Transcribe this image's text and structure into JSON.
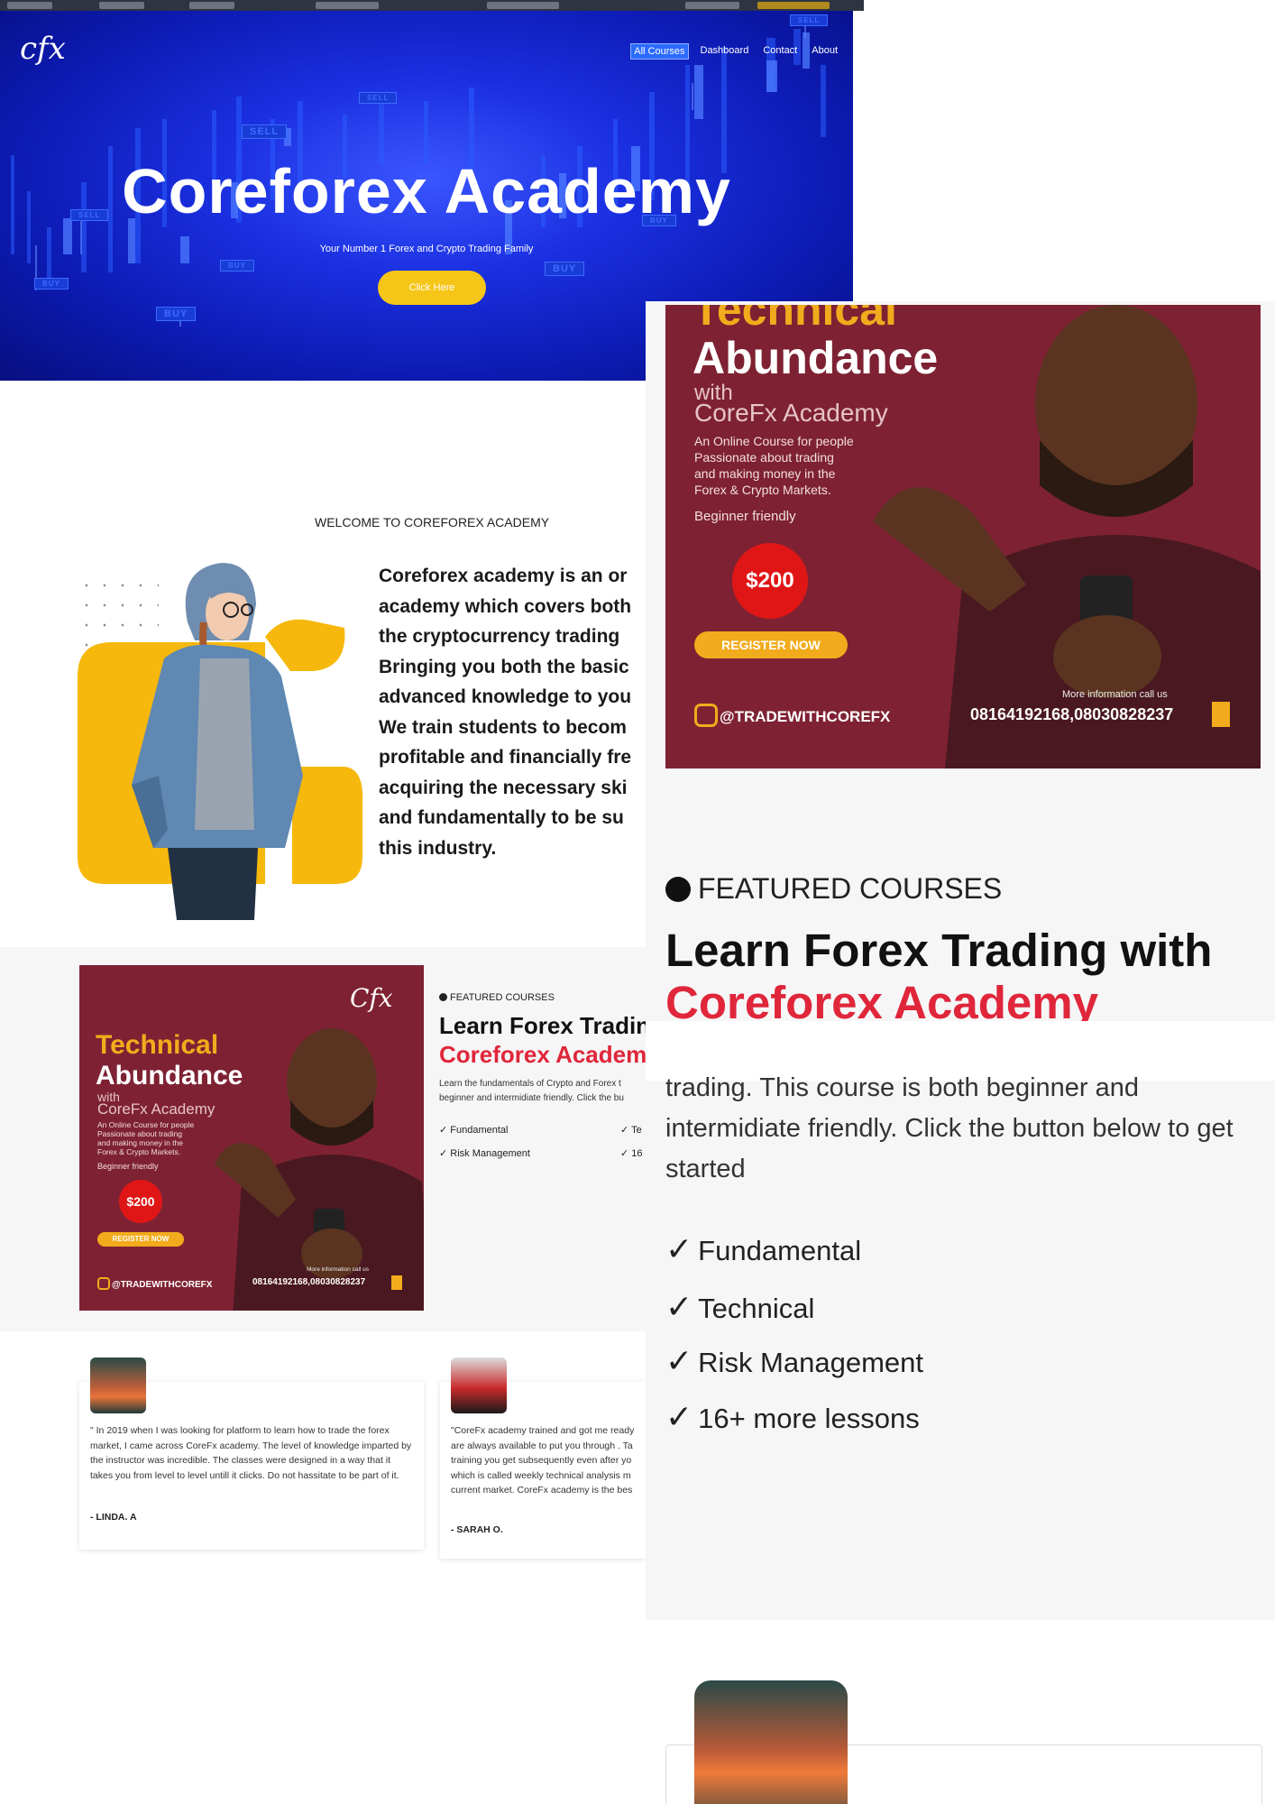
{
  "nav": {
    "logo": "cfx",
    "items": [
      "All Courses",
      "Dashboard",
      "Contact",
      "About"
    ]
  },
  "hero": {
    "title": "Coreforex Academy",
    "subtitle": "Your Number 1 Forex and Crypto Trading Family",
    "button": "Click Here",
    "tags": [
      "SELL",
      "SELL",
      "SELL",
      "SELL",
      "BUY",
      "BUY",
      "BUY",
      "BUY",
      "BUY"
    ]
  },
  "welcome": {
    "label": "WELCOME TO COREFOREX ACADEMY",
    "lines": [
      "Coreforex academy is an or",
      "academy which covers both",
      "the cryptocurrency trading",
      "Bringing you both the basic",
      "advanced knowledge to you",
      "We train students to becom",
      "profitable and financially fre",
      "acquiring the necessary ski",
      "and fundamentally to be su",
      "this industry."
    ]
  },
  "poster": {
    "title_line1": "Technical",
    "title_line2": "Abundance",
    "with": "with",
    "brand": "CoreFx Academy",
    "desc": [
      "An Online Course for people",
      "Passionate about trading",
      "and making money in the",
      "Forex & Crypto Markets."
    ],
    "beginner": "Beginner friendly",
    "price": "$200",
    "register": "REGISTER NOW",
    "instagram": "@TRADEWITHCOREFX",
    "more_info": "More information call us",
    "phones": "08164192168,08030828237",
    "logo": "Cfx"
  },
  "featured": {
    "label": "FEATURED COURSES",
    "heading1": "Learn Forex Trading with",
    "heading2": "Coreforex Academy",
    "desc_line1": "Learn the fundamentals of Crypto and Forex t",
    "desc_line2": "beginner and intermidiate friendly. Click the bu",
    "lessons": [
      "Fundamental",
      "Technical",
      "Risk Management",
      "16+ more lessons"
    ],
    "lessons_cut": [
      "Te",
      "16"
    ]
  },
  "testimonials": [
    {
      "quote": "\" In 2019 when I was looking for platform to learn how to trade the forex market, I came across CoreFx academy. The level of knowledge imparted by the instructor was incredible. The classes were designed in a way that it takes you from level to level untill it clicks. Do not hassitate to be part of it.",
      "name": "- LINDA. A"
    },
    {
      "quote_lines": [
        "\"CoreFx academy trained and got me ready",
        "are always available to put you through . Ta",
        "training you get subsequently even after yo",
        "which is called weekly technical analysis m",
        "current market. CoreFx academy is the bes"
      ],
      "name": "- SARAH O."
    }
  ],
  "zoom": {
    "poster_title_top": "Technical",
    "desc_lines": [
      "trading. This course is both beginner and",
      "intermidiate friendly. Click the button below to get",
      "started"
    ],
    "lessons": [
      "Fundamental",
      "Technical",
      "Risk Management",
      "16+ more lessons"
    ]
  },
  "colors": {
    "hero_blue": "#1a2fe0",
    "accent_yellow": "#f5c518",
    "poster_maroon": "#7e2233",
    "brand_red": "#e0263a"
  }
}
